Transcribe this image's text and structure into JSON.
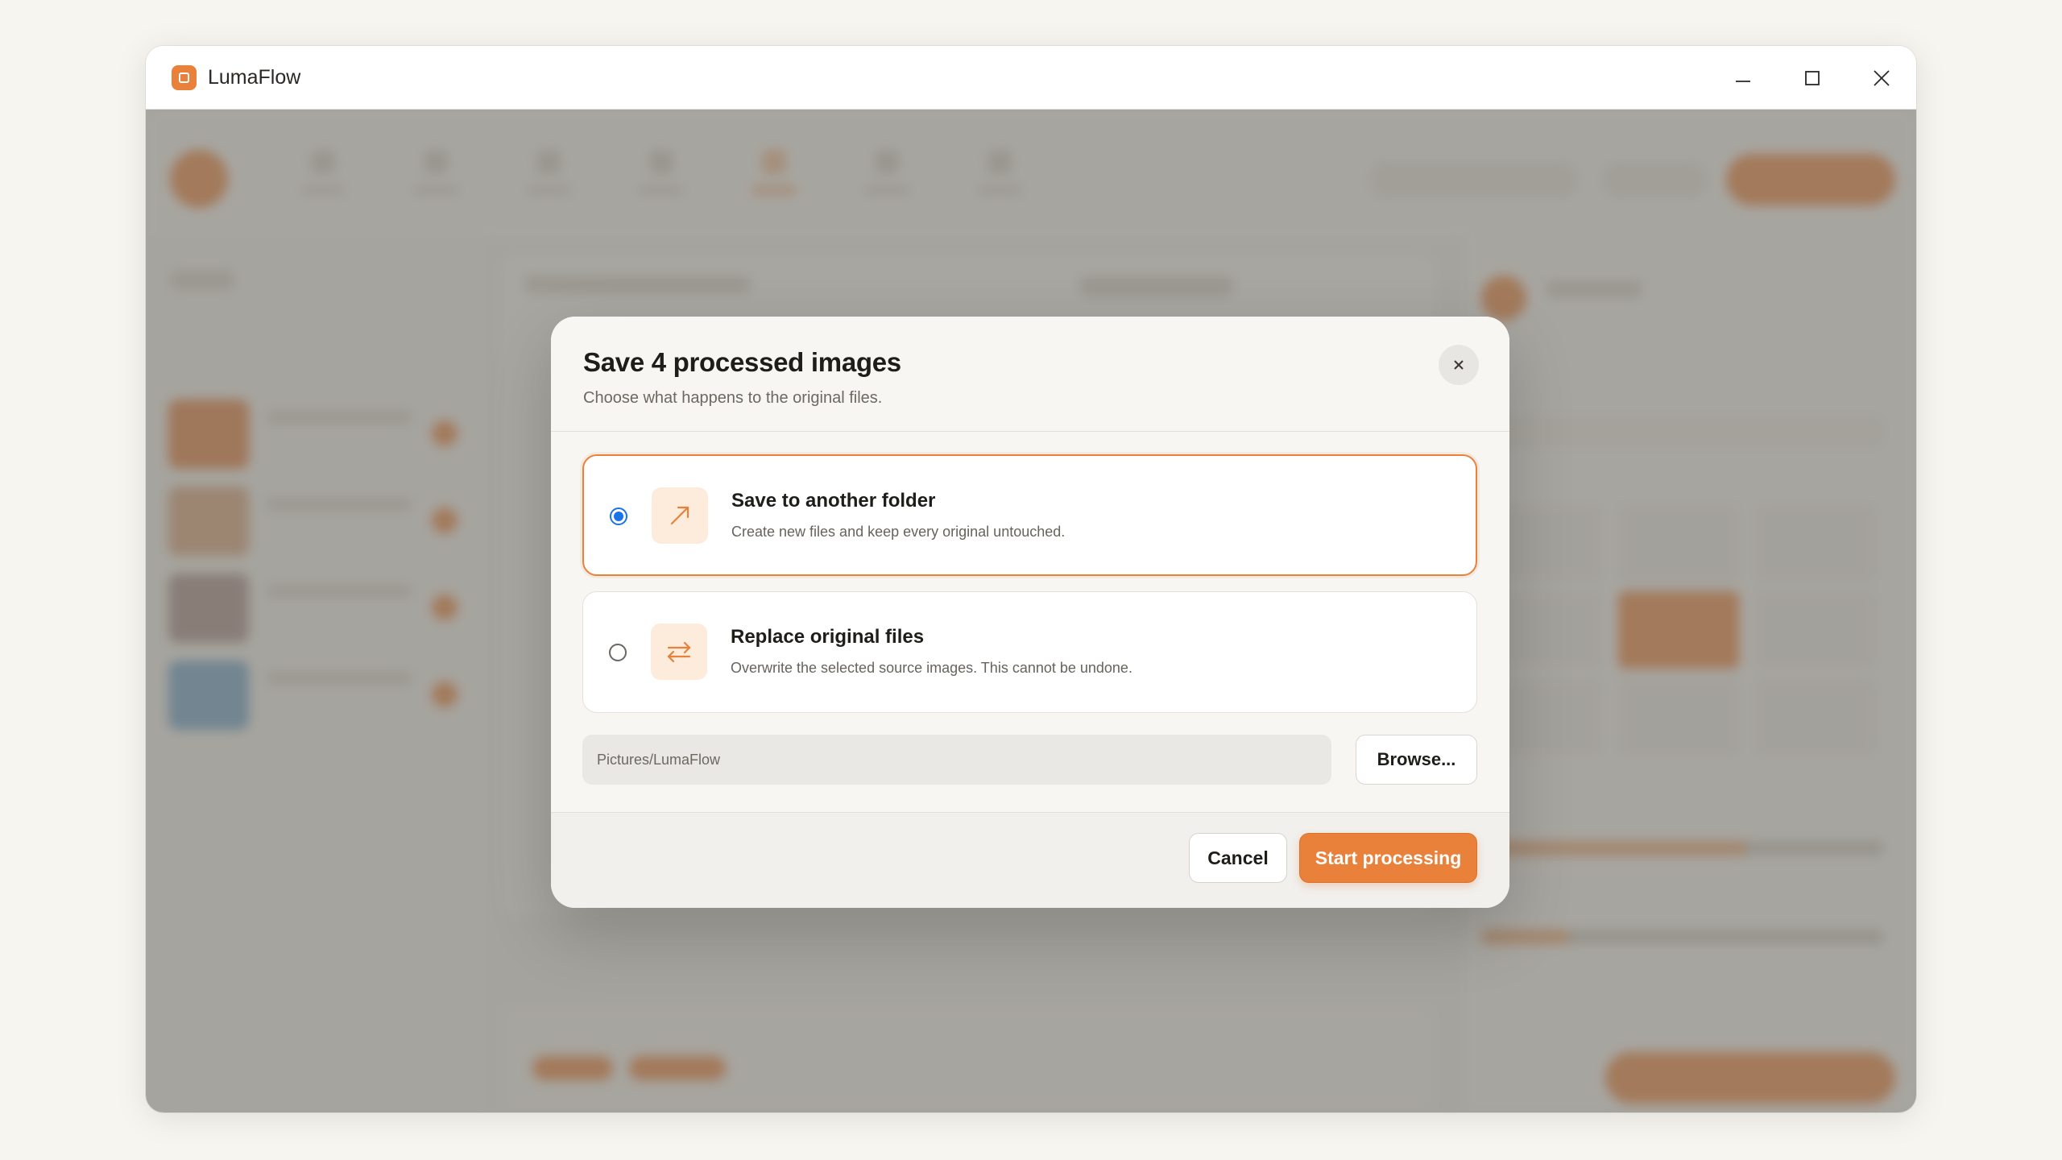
{
  "window": {
    "title": "LumaFlow",
    "accent_color": "#e9813b"
  },
  "dialog": {
    "title": "Save 4 processed images",
    "subtitle": "Choose what happens to the original files.",
    "options": [
      {
        "title": "Save to another folder",
        "description": "Create new files and keep every original untouched.",
        "icon": "arrow-up-right-icon",
        "selected": true
      },
      {
        "title": "Replace original files",
        "description": "Overwrite the selected source images. This cannot be undone.",
        "icon": "swap-arrows-icon",
        "selected": false
      }
    ],
    "path": {
      "value": "Pictures/LumaFlow",
      "placeholder": "Pictures/LumaFlow"
    },
    "browse_label": "Browse...",
    "cancel_label": "Cancel",
    "confirm_label": "Start processing"
  }
}
